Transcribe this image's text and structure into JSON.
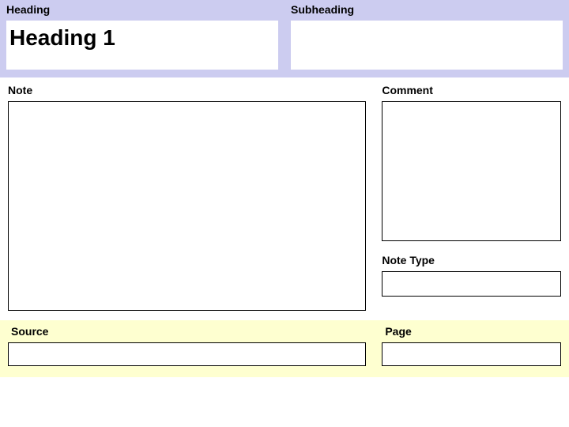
{
  "top": {
    "heading_label": "Heading",
    "heading_value": "Heading 1",
    "subheading_label": "Subheading",
    "subheading_value": ""
  },
  "mid": {
    "note_label": "Note",
    "note_value": "",
    "comment_label": "Comment",
    "comment_value": "",
    "notetype_label": "Note Type",
    "notetype_value": ""
  },
  "bottom": {
    "source_label": "Source",
    "source_value": "",
    "page_label": "Page",
    "page_value": ""
  }
}
